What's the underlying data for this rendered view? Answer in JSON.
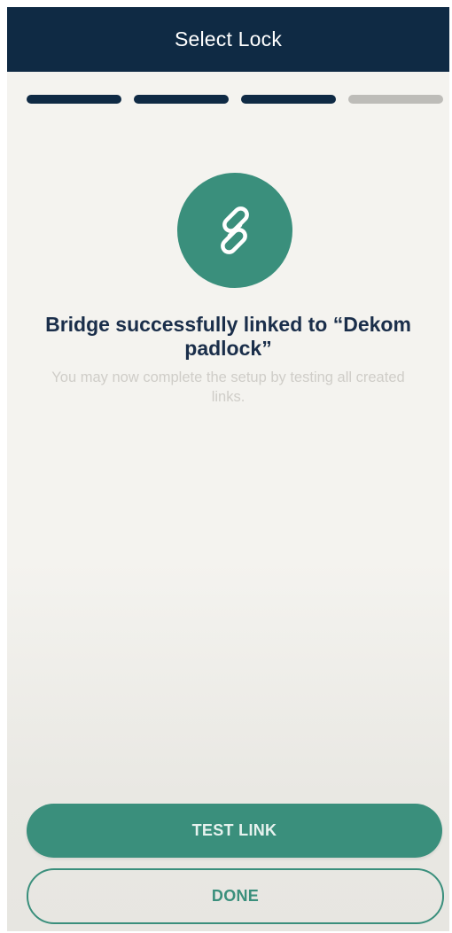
{
  "header": {
    "title": "Select Lock"
  },
  "progress": {
    "total_steps": 4,
    "completed_steps": 3,
    "active_color": "#0f2a44",
    "inactive_color": "#bdbcb8"
  },
  "status": {
    "icon": "link-icon",
    "icon_bg_color": "#3a8f7c",
    "title": "Bridge successfully linked to “Dekom padlock”",
    "subtitle": "You may now complete the setup by testing all created links."
  },
  "actions": {
    "test_link_label": "TEST LINK",
    "done_label": "DONE",
    "primary_color": "#3a8f7c",
    "secondary_border_color": "#3a8f7c"
  }
}
